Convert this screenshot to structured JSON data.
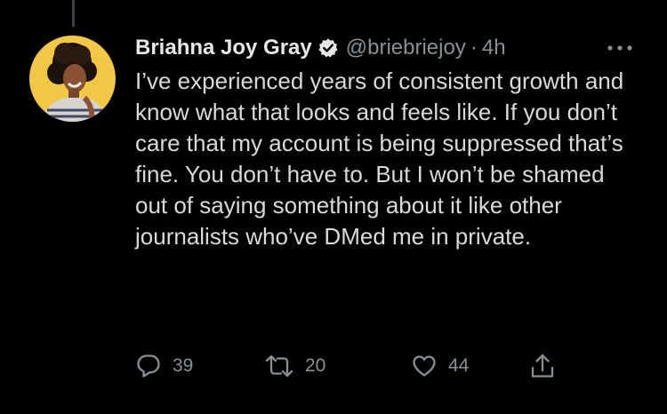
{
  "tweet": {
    "author": {
      "name": "Briahna Joy Gray",
      "handle": "@briebriejoy",
      "verified": true,
      "avatar": "profile-photo"
    },
    "separator": "·",
    "timestamp": "4h",
    "text": "I’ve experienced years of consistent growth and know what that looks and feels like. If you don’t care that my account is being suppressed that’s fine. You don’t have to. But I won’t be shamed out of saying something about it like other journalists who’ve DMed me in private.",
    "actions": {
      "reply_count": "39",
      "retweet_count": "20",
      "like_count": "44"
    }
  },
  "icons": {
    "reply": "speech-bubble-icon",
    "retweet": "retweet-arrows-icon",
    "like": "heart-icon",
    "share": "share-upload-icon",
    "more": "three-dots-icon",
    "verified": "verified-badge-icon"
  },
  "colors": {
    "background": "#000000",
    "primary_text": "#d9d9d9",
    "secondary_text": "#8a8f94",
    "thread_line": "#3d4146",
    "avatar_background": "#f2c745"
  }
}
